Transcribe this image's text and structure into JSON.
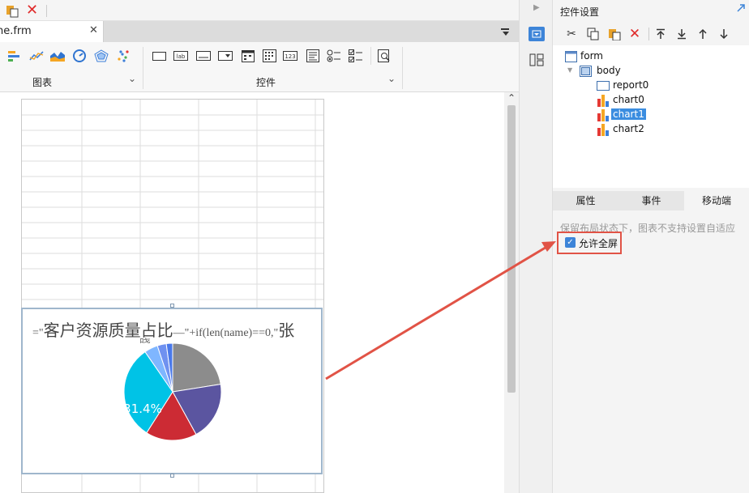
{
  "editor": {
    "tab_label": "one.frm",
    "tab_close": "✕",
    "ribbon": {
      "groups": [
        {
          "label": "图表",
          "chevron": "⌄"
        },
        {
          "label": "控件",
          "chevron": "⌄"
        }
      ],
      "ctrl_icon_labels": [
        "lab",
        "123"
      ]
    },
    "chart": {
      "formula_prefix": "=\"",
      "formula_title": "客户资源质量占比",
      "formula_mid": "—\"+if(len(name)==0,\"",
      "formula_tail": "张",
      "formula_line2": "晓",
      "pie_label": "31.4%",
      "pie": {
        "values": [
          22.5,
          19.5,
          17.0,
          31.4,
          4.5,
          3.0,
          2.1
        ],
        "colors": [
          "#8c8c8c",
          "#5b55a0",
          "#cc2b34",
          "#00c3e6",
          "#7fb6ff",
          "#6f91f0",
          "#4a79ea"
        ]
      }
    }
  },
  "panel": {
    "title": "控件设置",
    "tree": [
      {
        "label": "form",
        "icon": "form-icon"
      },
      {
        "label": "body",
        "icon": "body-icon"
      },
      {
        "label": "report0",
        "icon": "report-icon"
      },
      {
        "label": "chart0",
        "icon": "chart-icon"
      },
      {
        "label": "chart1",
        "icon": "chart-icon"
      },
      {
        "label": "chart2",
        "icon": "chart-icon"
      }
    ],
    "tabs": [
      "属性",
      "事件",
      "移动端"
    ],
    "notice": "保留布局状态下，图表不支持设置自适应",
    "fullscreen_label": "允许全屏",
    "fullscreen_checked": true
  },
  "colors": {
    "selection": "#3b8de0",
    "highlight_border": "#e15346",
    "arrow": "#e15346",
    "check": "#3d84d8"
  }
}
